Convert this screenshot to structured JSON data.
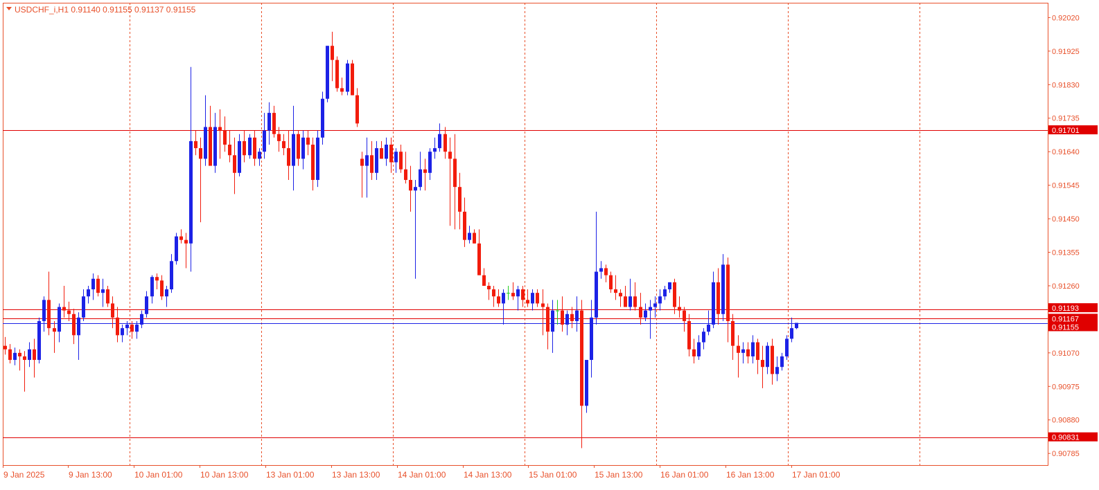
{
  "header": {
    "symbol_timeframe": "USDCHF_i,H1",
    "ohlc": "0.91140 0.91155 0.91137 0.91155",
    "collapse_icon": "triangle-down-icon"
  },
  "colors": {
    "background": "#ffffff",
    "frame": "#e8502a",
    "axis_text": "#e8502a",
    "bull": "#1c22e6",
    "bear": "#f21c0c",
    "doji": "#22cc22",
    "grid_separator": "#e8502a",
    "support_line": "#e00000",
    "price_line": "#1c22e6",
    "label_bg": "#e00000",
    "label_text": "#ffffff"
  },
  "chart_data": {
    "type": "candlestick",
    "symbol": "USDCHF_i",
    "timeframe": "H1",
    "ylim": [
      0.90785,
      0.9206
    ],
    "y_ticks": [
      "0.92020",
      "0.91925",
      "0.91830",
      "0.91735",
      "0.91640",
      "0.91545",
      "0.91450",
      "0.91355",
      "0.91260",
      "0.90975",
      "0.91070",
      "0.90880",
      "0.90785"
    ],
    "x_ticks": [
      "9 Jan 2025",
      "9 Jan 13:00",
      "10 Jan 01:00",
      "10 Jan 13:00",
      "13 Jan 01:00",
      "13 Jan 13:00",
      "14 Jan 01:00",
      "14 Jan 13:00",
      "15 Jan 01:00",
      "15 Jan 13:00",
      "16 Jan 01:00",
      "16 Jan 13:00",
      "17 Jan 01:00"
    ],
    "session_separators": [
      "10 Jan 01:00",
      "10 Jan 13:00",
      "13 Jan 01:00",
      "13 Jan 13:00",
      "14 Jan 01:00",
      "14 Jan 13:00",
      "15 Jan 01:00",
      "15 Jan 13:00",
      "16 Jan 01:00",
      "16 Jan 13:00",
      "17 Jan 01:00",
      "17 Jan 13:00"
    ],
    "horizontal_levels": [
      {
        "price": 0.91701,
        "label": "0.91701",
        "kind": "level"
      },
      {
        "price": 0.91193,
        "label": "0.91193",
        "kind": "level"
      },
      {
        "price": 0.91167,
        "label": "0.91167",
        "kind": "level"
      },
      {
        "price": 0.91155,
        "label": "0.91155",
        "kind": "bid"
      },
      {
        "price": 0.90831,
        "label": "0.90831",
        "kind": "level"
      }
    ],
    "candles": [
      [
        0.9109,
        0.91115,
        0.91065,
        0.9108
      ],
      [
        0.9108,
        0.91095,
        0.9104,
        0.9105
      ],
      [
        0.9105,
        0.91085,
        0.91035,
        0.9107
      ],
      [
        0.9107,
        0.9108,
        0.9102,
        0.9106
      ],
      [
        0.9106,
        0.91075,
        0.9096,
        0.9105
      ],
      [
        0.9105,
        0.911,
        0.9103,
        0.9108
      ],
      [
        0.9108,
        0.9111,
        0.91,
        0.9105
      ],
      [
        0.9105,
        0.9117,
        0.9104,
        0.9116
      ],
      [
        0.9116,
        0.9123,
        0.9113,
        0.9122
      ],
      [
        0.9122,
        0.913,
        0.9112,
        0.9114
      ],
      [
        0.9114,
        0.9116,
        0.9107,
        0.9113
      ],
      [
        0.9113,
        0.9121,
        0.911,
        0.912
      ],
      [
        0.912,
        0.9126,
        0.9117,
        0.9119
      ],
      [
        0.9119,
        0.91215,
        0.9116,
        0.9118
      ],
      [
        0.9118,
        0.91195,
        0.91095,
        0.9112
      ],
      [
        0.9112,
        0.91185,
        0.9105,
        0.9117
      ],
      [
        0.9117,
        0.9125,
        0.9116,
        0.9123
      ],
      [
        0.9123,
        0.9126,
        0.9121,
        0.9125
      ],
      [
        0.9125,
        0.91295,
        0.9122,
        0.9128
      ],
      [
        0.9128,
        0.9129,
        0.9123,
        0.9124
      ],
      [
        0.9124,
        0.9128,
        0.912,
        0.9125
      ],
      [
        0.9125,
        0.9126,
        0.912,
        0.9121
      ],
      [
        0.9121,
        0.9123,
        0.9114,
        0.9117
      ],
      [
        0.9117,
        0.912,
        0.911,
        0.9112
      ],
      [
        0.9112,
        0.9115,
        0.911,
        0.9114
      ],
      [
        0.9114,
        0.9116,
        0.9112,
        0.9115
      ],
      [
        0.9115,
        0.9116,
        0.9111,
        0.9113
      ],
      [
        0.9113,
        0.9116,
        0.9111,
        0.9115
      ],
      [
        0.9115,
        0.9119,
        0.9114,
        0.9118
      ],
      [
        0.9118,
        0.91245,
        0.9117,
        0.9123
      ],
      [
        0.9123,
        0.9129,
        0.9121,
        0.91285
      ],
      [
        0.91285,
        0.91295,
        0.9125,
        0.91275
      ],
      [
        0.91275,
        0.9129,
        0.9122,
        0.9123
      ],
      [
        0.9123,
        0.9126,
        0.912,
        0.9125
      ],
      [
        0.9125,
        0.9135,
        0.9124,
        0.9133
      ],
      [
        0.9133,
        0.9141,
        0.9132,
        0.914
      ],
      [
        0.914,
        0.9142,
        0.9138,
        0.9139
      ],
      [
        0.9139,
        0.9141,
        0.9131,
        0.9138
      ],
      [
        0.9138,
        0.9188,
        0.913,
        0.9167
      ],
      [
        0.9167,
        0.917,
        0.9163,
        0.9165
      ],
      [
        0.9165,
        0.9168,
        0.9144,
        0.9162
      ],
      [
        0.9162,
        0.918,
        0.916,
        0.9171
      ],
      [
        0.9171,
        0.9177,
        0.9161,
        0.916
      ],
      [
        0.916,
        0.9175,
        0.9158,
        0.9171
      ],
      [
        0.9171,
        0.9176,
        0.9162,
        0.917
      ],
      [
        0.917,
        0.9174,
        0.9164,
        0.9166
      ],
      [
        0.9166,
        0.917,
        0.9161,
        0.9163
      ],
      [
        0.9163,
        0.9168,
        0.9152,
        0.9158
      ],
      [
        0.9158,
        0.9169,
        0.9157,
        0.9167
      ],
      [
        0.9167,
        0.917,
        0.9161,
        0.9163
      ],
      [
        0.9163,
        0.9169,
        0.9162,
        0.9168
      ],
      [
        0.9168,
        0.917,
        0.916,
        0.9162
      ],
      [
        0.9162,
        0.9165,
        0.916,
        0.9164
      ],
      [
        0.9164,
        0.9175,
        0.9162,
        0.917
      ],
      [
        0.917,
        0.9178,
        0.9166,
        0.9175
      ],
      [
        0.9175,
        0.9177,
        0.9168,
        0.9169
      ],
      [
        0.9169,
        0.9171,
        0.9164,
        0.9167
      ],
      [
        0.9167,
        0.9169,
        0.9163,
        0.9165
      ],
      [
        0.9165,
        0.917,
        0.9156,
        0.916
      ],
      [
        0.916,
        0.9177,
        0.9153,
        0.9169
      ],
      [
        0.9169,
        0.917,
        0.916,
        0.9162
      ],
      [
        0.9162,
        0.917,
        0.9159,
        0.9168
      ],
      [
        0.9168,
        0.917,
        0.9163,
        0.9166
      ],
      [
        0.9166,
        0.9168,
        0.9153,
        0.9156
      ],
      [
        0.9156,
        0.917,
        0.9154,
        0.9168
      ],
      [
        0.9168,
        0.9181,
        0.9166,
        0.9179
      ],
      [
        0.9179,
        0.9194,
        0.9178,
        0.9194
      ],
      [
        0.9194,
        0.9198,
        0.9184,
        0.919
      ],
      [
        0.919,
        0.9191,
        0.9181,
        0.9182
      ],
      [
        0.9182,
        0.9185,
        0.918,
        0.9181
      ],
      [
        0.9181,
        0.919,
        0.918,
        0.9189
      ],
      [
        0.9189,
        0.919,
        0.918,
        0.918
      ],
      [
        0.918,
        0.9182,
        0.9171,
        0.9172
      ],
      [
        0.9162,
        0.9164,
        0.9151,
        0.916
      ],
      [
        0.916,
        0.9168,
        0.9151,
        0.9163
      ],
      [
        0.9163,
        0.9167,
        0.9156,
        0.9158
      ],
      [
        0.9158,
        0.9167,
        0.9156,
        0.9165
      ],
      [
        0.9165,
        0.9167,
        0.9162,
        0.9162
      ],
      [
        0.9162,
        0.9168,
        0.916,
        0.9166
      ],
      [
        0.9166,
        0.9168,
        0.9158,
        0.9161
      ],
      [
        0.9161,
        0.9165,
        0.9158,
        0.9164
      ],
      [
        0.9164,
        0.9166,
        0.9158,
        0.9159
      ],
      [
        0.9159,
        0.9164,
        0.9155,
        0.9156
      ],
      [
        0.9156,
        0.916,
        0.9147,
        0.9153
      ],
      [
        0.9153,
        0.9156,
        0.9128,
        0.9154
      ],
      [
        0.9154,
        0.9164,
        0.9153,
        0.9159
      ],
      [
        0.9159,
        0.9162,
        0.9153,
        0.9158
      ],
      [
        0.9158,
        0.9165,
        0.9156,
        0.9164
      ],
      [
        0.9164,
        0.9168,
        0.9162,
        0.9165
      ],
      [
        0.9165,
        0.9172,
        0.9164,
        0.9169
      ],
      [
        0.9169,
        0.9171,
        0.9162,
        0.9164
      ],
      [
        0.9164,
        0.9168,
        0.9143,
        0.9162
      ],
      [
        0.9162,
        0.9169,
        0.9142,
        0.9154
      ],
      [
        0.9154,
        0.9158,
        0.9142,
        0.9147
      ],
      [
        0.9147,
        0.9151,
        0.9137,
        0.9139
      ],
      [
        0.9139,
        0.9143,
        0.9138,
        0.9141
      ],
      [
        0.9141,
        0.9142,
        0.9138,
        0.9138
      ],
      [
        0.9138,
        0.9142,
        0.9129,
        0.9129
      ],
      [
        0.9129,
        0.9131,
        0.9126,
        0.9126
      ],
      [
        0.9126,
        0.9127,
        0.9122,
        0.9125
      ],
      [
        0.9125,
        0.9126,
        0.912,
        0.9123
      ],
      [
        0.9123,
        0.9125,
        0.912,
        0.9121
      ],
      [
        0.9121,
        0.9125,
        0.9115,
        0.9124
      ],
      [
        0.9124,
        0.9126,
        0.9122,
        0.9124
      ],
      [
        0.9124,
        0.9127,
        0.9122,
        0.9123
      ],
      [
        0.9123,
        0.9126,
        0.9119,
        0.9125
      ],
      [
        0.9125,
        0.9126,
        0.912,
        0.9122
      ],
      [
        0.9122,
        0.9125,
        0.912,
        0.9121
      ],
      [
        0.9121,
        0.9125,
        0.9119,
        0.9124
      ],
      [
        0.9124,
        0.9125,
        0.912,
        0.9121
      ],
      [
        0.9121,
        0.9125,
        0.9112,
        0.912
      ],
      [
        0.912,
        0.9121,
        0.9108,
        0.9113
      ],
      [
        0.9113,
        0.9122,
        0.9107,
        0.9119
      ],
      [
        0.9119,
        0.9122,
        0.9115,
        0.9119
      ],
      [
        0.9119,
        0.9123,
        0.9113,
        0.9115
      ],
      [
        0.9115,
        0.9119,
        0.9112,
        0.9118
      ],
      [
        0.9118,
        0.912,
        0.9114,
        0.9116
      ],
      [
        0.9116,
        0.9123,
        0.9113,
        0.9119
      ],
      [
        0.9119,
        0.9122,
        0.908,
        0.9092
      ],
      [
        0.9092,
        0.9103,
        0.909,
        0.9105
      ],
      [
        0.9105,
        0.9122,
        0.91,
        0.9117
      ],
      [
        0.9117,
        0.9147,
        0.9115,
        0.913
      ],
      [
        0.913,
        0.9133,
        0.9128,
        0.9131
      ],
      [
        0.9131,
        0.9132,
        0.9127,
        0.9129
      ],
      [
        0.9129,
        0.913,
        0.9124,
        0.9125
      ],
      [
        0.9125,
        0.9129,
        0.9122,
        0.9124
      ],
      [
        0.9124,
        0.9125,
        0.912,
        0.9123
      ],
      [
        0.9123,
        0.9126,
        0.912,
        0.912
      ],
      [
        0.912,
        0.9128,
        0.9119,
        0.9123
      ],
      [
        0.9123,
        0.9127,
        0.9119,
        0.912
      ],
      [
        0.912,
        0.9124,
        0.9115,
        0.9117
      ],
      [
        0.9117,
        0.9121,
        0.9116,
        0.9119
      ],
      [
        0.9119,
        0.9122,
        0.9111,
        0.912
      ],
      [
        0.912,
        0.9123,
        0.9117,
        0.9121
      ],
      [
        0.9121,
        0.9125,
        0.9119,
        0.9123
      ],
      [
        0.9123,
        0.9126,
        0.9122,
        0.9125
      ],
      [
        0.9125,
        0.9127,
        0.9124,
        0.9127
      ],
      [
        0.9127,
        0.9128,
        0.9118,
        0.912
      ],
      [
        0.912,
        0.9123,
        0.9117,
        0.9119
      ],
      [
        0.9119,
        0.912,
        0.9113,
        0.9116
      ],
      [
        0.9116,
        0.9118,
        0.9106,
        0.9108
      ],
      [
        0.9108,
        0.9111,
        0.9104,
        0.9106
      ],
      [
        0.9106,
        0.9112,
        0.9105,
        0.911
      ],
      [
        0.911,
        0.9114,
        0.9108,
        0.9113
      ],
      [
        0.9113,
        0.9119,
        0.9112,
        0.9115
      ],
      [
        0.9115,
        0.913,
        0.9114,
        0.9127
      ],
      [
        0.9127,
        0.9131,
        0.9115,
        0.9118
      ],
      [
        0.9118,
        0.9135,
        0.9116,
        0.9132
      ],
      [
        0.9132,
        0.9134,
        0.911,
        0.9116
      ],
      [
        0.9116,
        0.9118,
        0.9105,
        0.9109
      ],
      [
        0.9109,
        0.9112,
        0.91,
        0.9107
      ],
      [
        0.9107,
        0.911,
        0.9104,
        0.9108
      ],
      [
        0.9108,
        0.911,
        0.9104,
        0.9106
      ],
      [
        0.9106,
        0.9112,
        0.9104,
        0.911
      ],
      [
        0.911,
        0.9111,
        0.9101,
        0.9105
      ],
      [
        0.9105,
        0.9109,
        0.9097,
        0.9103
      ],
      [
        0.9103,
        0.911,
        0.9101,
        0.9109
      ],
      [
        0.9109,
        0.9111,
        0.9098,
        0.9101
      ],
      [
        0.9101,
        0.9106,
        0.9099,
        0.9103
      ],
      [
        0.9103,
        0.9107,
        0.9102,
        0.9106
      ],
      [
        0.9106,
        0.9112,
        0.9105,
        0.9111
      ],
      [
        0.9111,
        0.9117,
        0.911,
        0.9114
      ],
      [
        0.9114,
        0.91155,
        0.91137,
        0.91155
      ]
    ]
  }
}
